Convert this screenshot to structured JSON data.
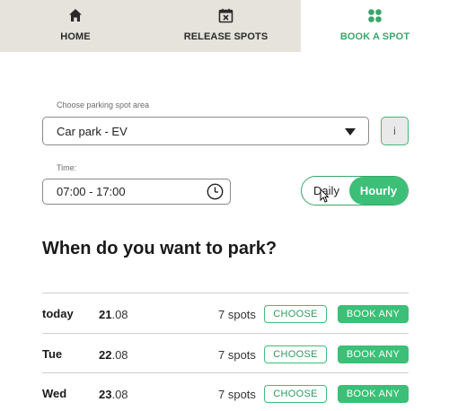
{
  "nav": {
    "tabs": [
      {
        "label": "HOME",
        "icon": "home-icon",
        "active": false
      },
      {
        "label": "RELEASE SPOTS",
        "icon": "calendar-x-icon",
        "active": false
      },
      {
        "label": "BOOK A SPOT",
        "icon": "grid-dots-icon",
        "active": true
      }
    ]
  },
  "colors": {
    "accent": "#3cbf77",
    "nav_bg": "#e6e3dc",
    "text": "#1f1f1f"
  },
  "area": {
    "label": "Choose parking spot area",
    "selected": "Car park - EV",
    "info_label": "i"
  },
  "time": {
    "label": "Time:",
    "value": "07:00 - 17:00"
  },
  "mode_toggle": {
    "options": [
      "Daily",
      "Hourly"
    ],
    "selected": "Hourly"
  },
  "heading": "When do you want to park?",
  "days": [
    {
      "day": "today",
      "date_day": "21",
      "date_month": ".08",
      "spots": "7 spots",
      "choose_label": "CHOOSE",
      "book_label": "BOOK ANY"
    },
    {
      "day": "Tue",
      "date_day": "22",
      "date_month": ".08",
      "spots": "7 spots",
      "choose_label": "CHOOSE",
      "book_label": "BOOK ANY"
    },
    {
      "day": "Wed",
      "date_day": "23",
      "date_month": ".08",
      "spots": "7 spots",
      "choose_label": "CHOOSE",
      "book_label": "BOOK ANY"
    }
  ]
}
